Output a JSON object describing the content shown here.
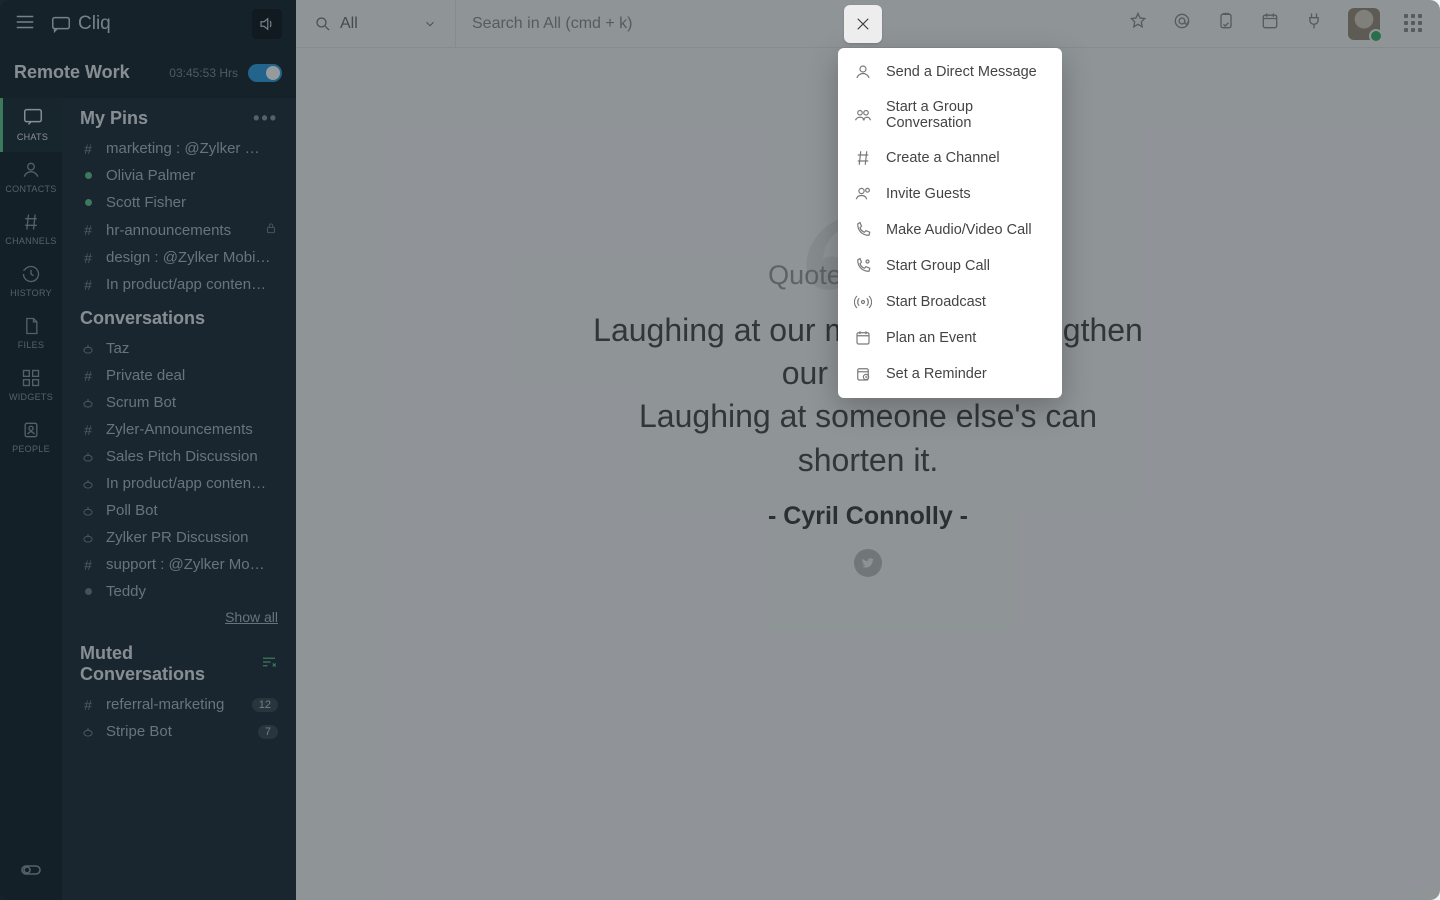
{
  "brand": {
    "name": "Cliq"
  },
  "status": {
    "title": "Remote Work",
    "timer": "03:45:53 Hrs"
  },
  "rail": [
    {
      "label": "CHATS",
      "icon": "chat-icon"
    },
    {
      "label": "CONTACTS",
      "icon": "person-icon"
    },
    {
      "label": "CHANNELS",
      "icon": "hash-icon"
    },
    {
      "label": "HISTORY",
      "icon": "history-icon"
    },
    {
      "label": "FILES",
      "icon": "file-icon"
    },
    {
      "label": "WIDGETS",
      "icon": "widgets-icon"
    },
    {
      "label": "PEOPLE",
      "icon": "people-icon"
    }
  ],
  "pins": {
    "heading": "My Pins",
    "items": [
      {
        "kind": "hash",
        "label": "marketing : @Zylker …"
      },
      {
        "kind": "dot",
        "label": "Olivia Palmer",
        "dot": "green"
      },
      {
        "kind": "dot",
        "label": "Scott Fisher",
        "dot": "green"
      },
      {
        "kind": "hash",
        "label": "hr-announcements",
        "locked": true
      },
      {
        "kind": "hash",
        "label": "design : @Zylker Mobi…"
      },
      {
        "kind": "hash",
        "label": "In product/app conten…"
      }
    ]
  },
  "conversations": {
    "heading": "Conversations",
    "items": [
      {
        "kind": "bot",
        "label": "Taz"
      },
      {
        "kind": "hash",
        "label": "Private deal"
      },
      {
        "kind": "bot",
        "label": "Scrum Bot"
      },
      {
        "kind": "hash",
        "label": "Zyler-Announcements"
      },
      {
        "kind": "bot",
        "label": "Sales Pitch Discussion"
      },
      {
        "kind": "bot",
        "label": "In product/app conten…"
      },
      {
        "kind": "bot",
        "label": "Poll Bot"
      },
      {
        "kind": "bot",
        "label": "Zylker PR Discussion"
      },
      {
        "kind": "hash",
        "label": "support : @Zylker Mo…"
      },
      {
        "kind": "dot",
        "label": "Teddy",
        "dot": "gray"
      }
    ],
    "show_all": "Show all"
  },
  "muted": {
    "heading": "Muted Conversations",
    "items": [
      {
        "kind": "hash",
        "label": "referral-marketing",
        "badge": "12"
      },
      {
        "kind": "bot",
        "label": "Stripe Bot",
        "badge": "7"
      }
    ]
  },
  "topbar": {
    "scope_label": "All",
    "search_placeholder": "Search in All (cmd + k)"
  },
  "compose_menu": [
    {
      "icon": "person-icon",
      "label": "Send a Direct Message"
    },
    {
      "icon": "group-icon",
      "label": "Start a Group Conversation"
    },
    {
      "icon": "hash-icon",
      "label": "Create a Channel"
    },
    {
      "icon": "guests-icon",
      "label": "Invite Guests"
    },
    {
      "icon": "phone-icon",
      "label": "Make Audio/Video Call"
    },
    {
      "icon": "phone-group-icon",
      "label": "Start Group Call"
    },
    {
      "icon": "broadcast-icon",
      "label": "Start Broadcast"
    },
    {
      "icon": "calendar-icon",
      "label": "Plan an Event"
    },
    {
      "icon": "reminder-icon",
      "label": "Set a Reminder"
    }
  ],
  "quote": {
    "title": "Quote of the day",
    "line1": "Laughing at our mistakes can lengthen our own life.",
    "line2": "Laughing at someone else's can shorten it.",
    "author": "Cyril Connolly"
  }
}
